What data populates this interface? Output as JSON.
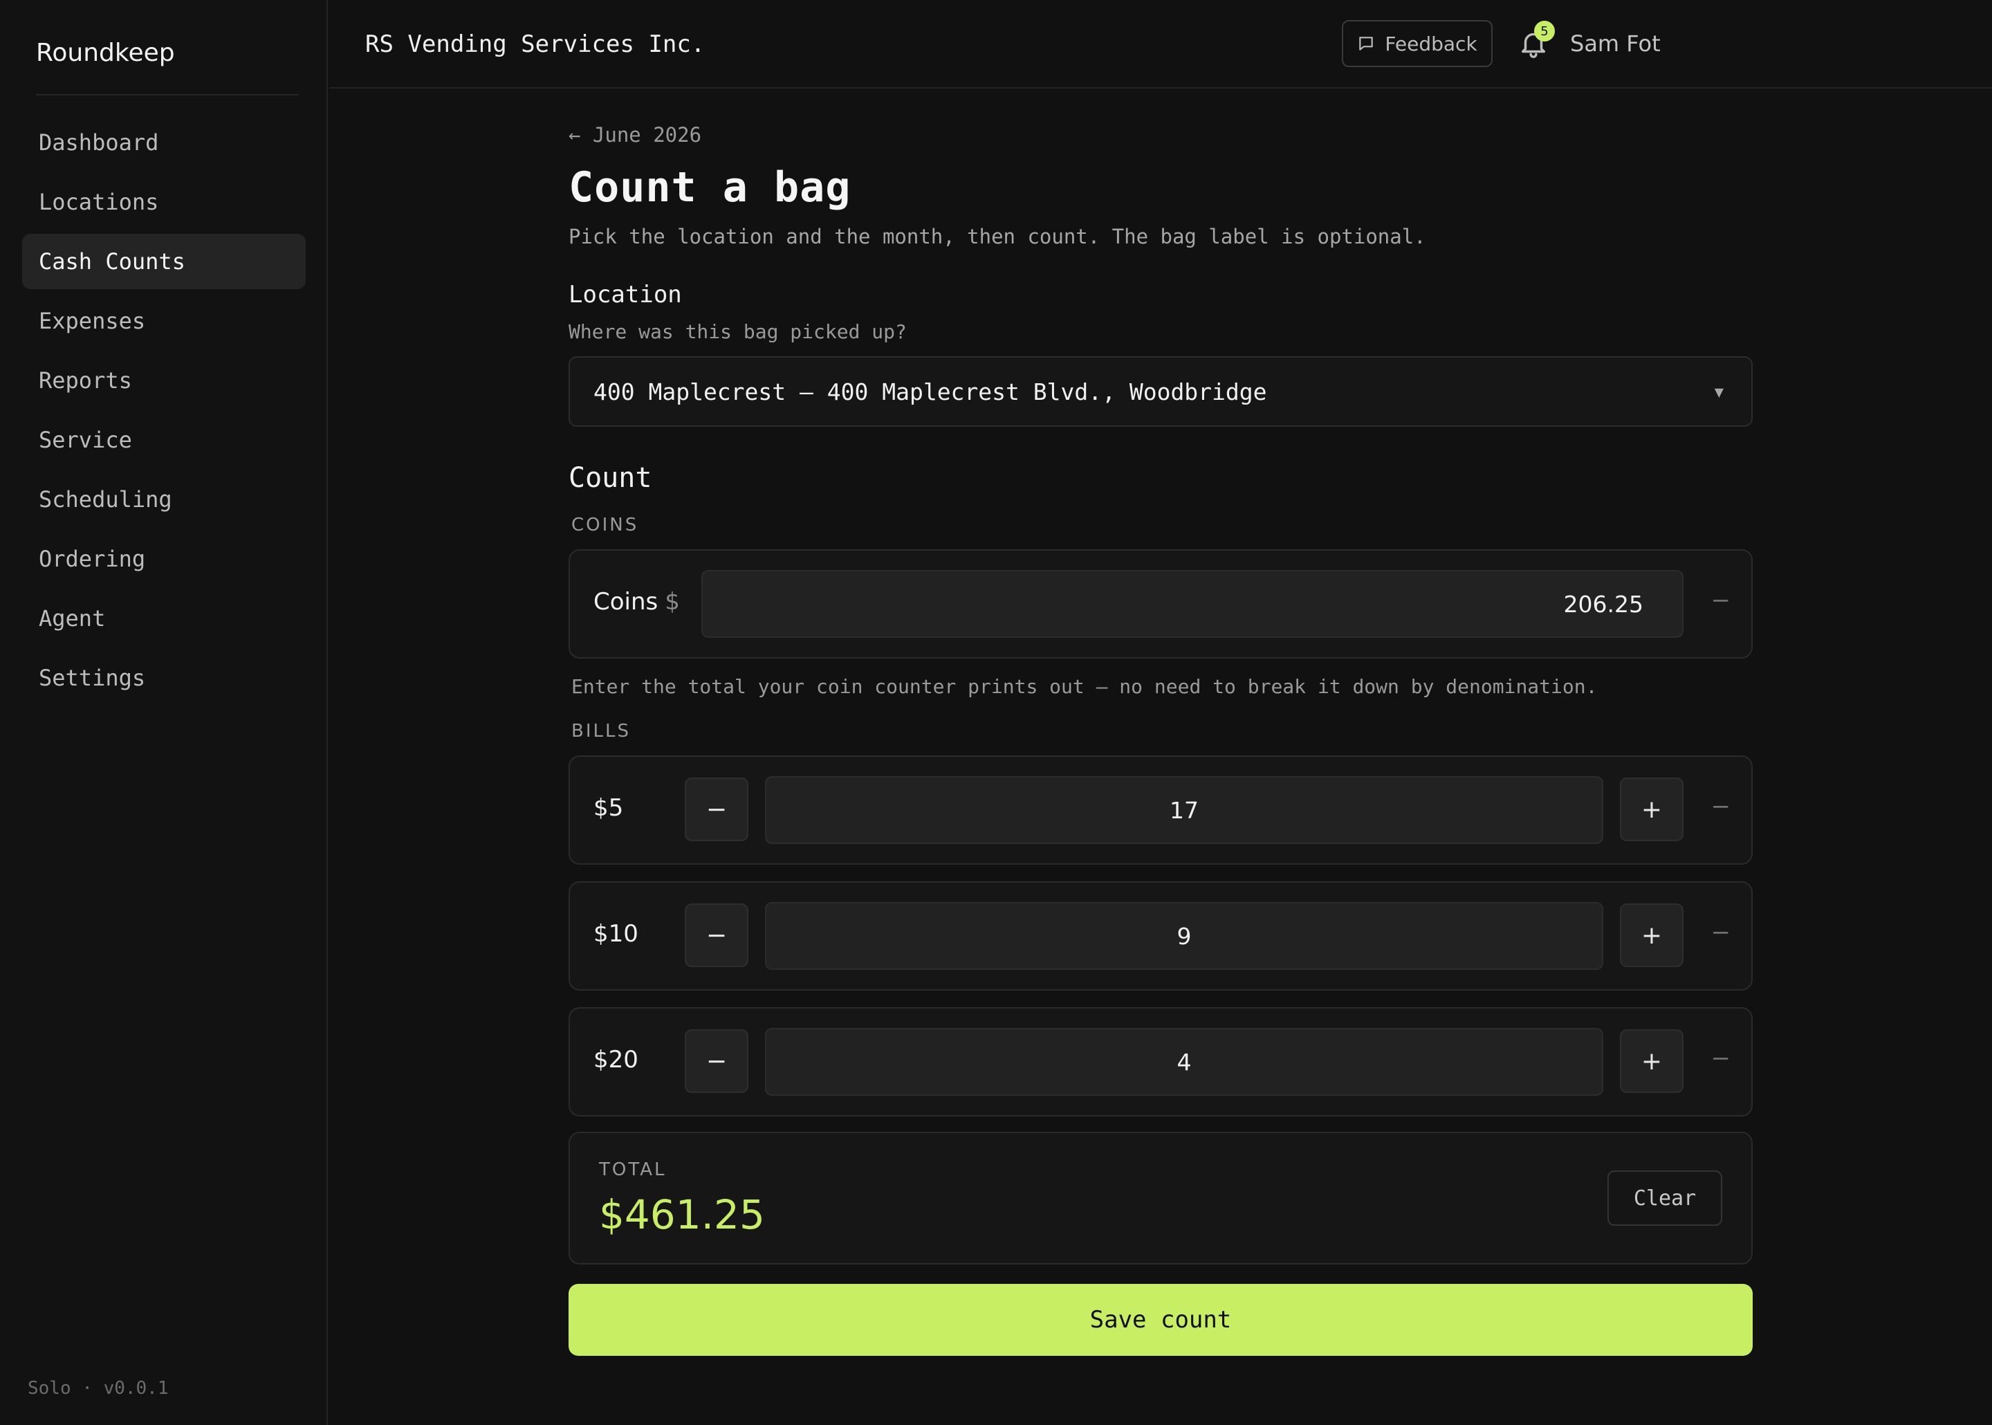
{
  "app": {
    "brand": "Roundkeep",
    "version": "Solo · v0.0.1"
  },
  "sidebar": {
    "items": [
      {
        "label": "Dashboard",
        "active": false
      },
      {
        "label": "Locations",
        "active": false
      },
      {
        "label": "Cash Counts",
        "active": true
      },
      {
        "label": "Expenses",
        "active": false
      },
      {
        "label": "Reports",
        "active": false
      },
      {
        "label": "Service",
        "active": false
      },
      {
        "label": "Scheduling",
        "active": false
      },
      {
        "label": "Ordering",
        "active": false
      },
      {
        "label": "Agent",
        "active": false
      },
      {
        "label": "Settings",
        "active": false
      }
    ]
  },
  "header": {
    "org_name": "RS Vending Services Inc.",
    "feedback_label": "Feedback",
    "notification_count": "5",
    "user_name": "Sam Fot"
  },
  "page": {
    "back_link": "← June 2026",
    "title": "Count a bag",
    "subtitle": "Pick the location and the month, then count. The bag label is optional."
  },
  "location": {
    "label": "Location",
    "help": "Where was this bag picked up?",
    "selected": "400 Maplecrest — 400 Maplecrest Blvd., Woodbridge"
  },
  "count": {
    "title": "Count",
    "coins_heading": "COINS",
    "coins_label": "Coins",
    "coins_currency": "$",
    "coins_value": "206.25",
    "coins_help": "Enter the total your coin counter prints out — no need to break it down by denomination.",
    "bills_heading": "BILLS",
    "bills": [
      {
        "denomination": "$5",
        "quantity": "17"
      },
      {
        "denomination": "$10",
        "quantity": "9"
      },
      {
        "denomination": "$20",
        "quantity": "4"
      }
    ],
    "decrement_symbol": "−",
    "increment_symbol": "+",
    "remove_symbol": "−"
  },
  "total": {
    "label": "TOTAL",
    "value": "$461.25",
    "clear_label": "Clear"
  },
  "actions": {
    "save_label": "Save count"
  },
  "colors": {
    "accent": "#c8ef63",
    "background": "#111111",
    "card": "#161616"
  },
  "icons": {
    "feedback": "message-square-icon",
    "notifications": "bell-icon",
    "select": "chevron-down-icon"
  }
}
